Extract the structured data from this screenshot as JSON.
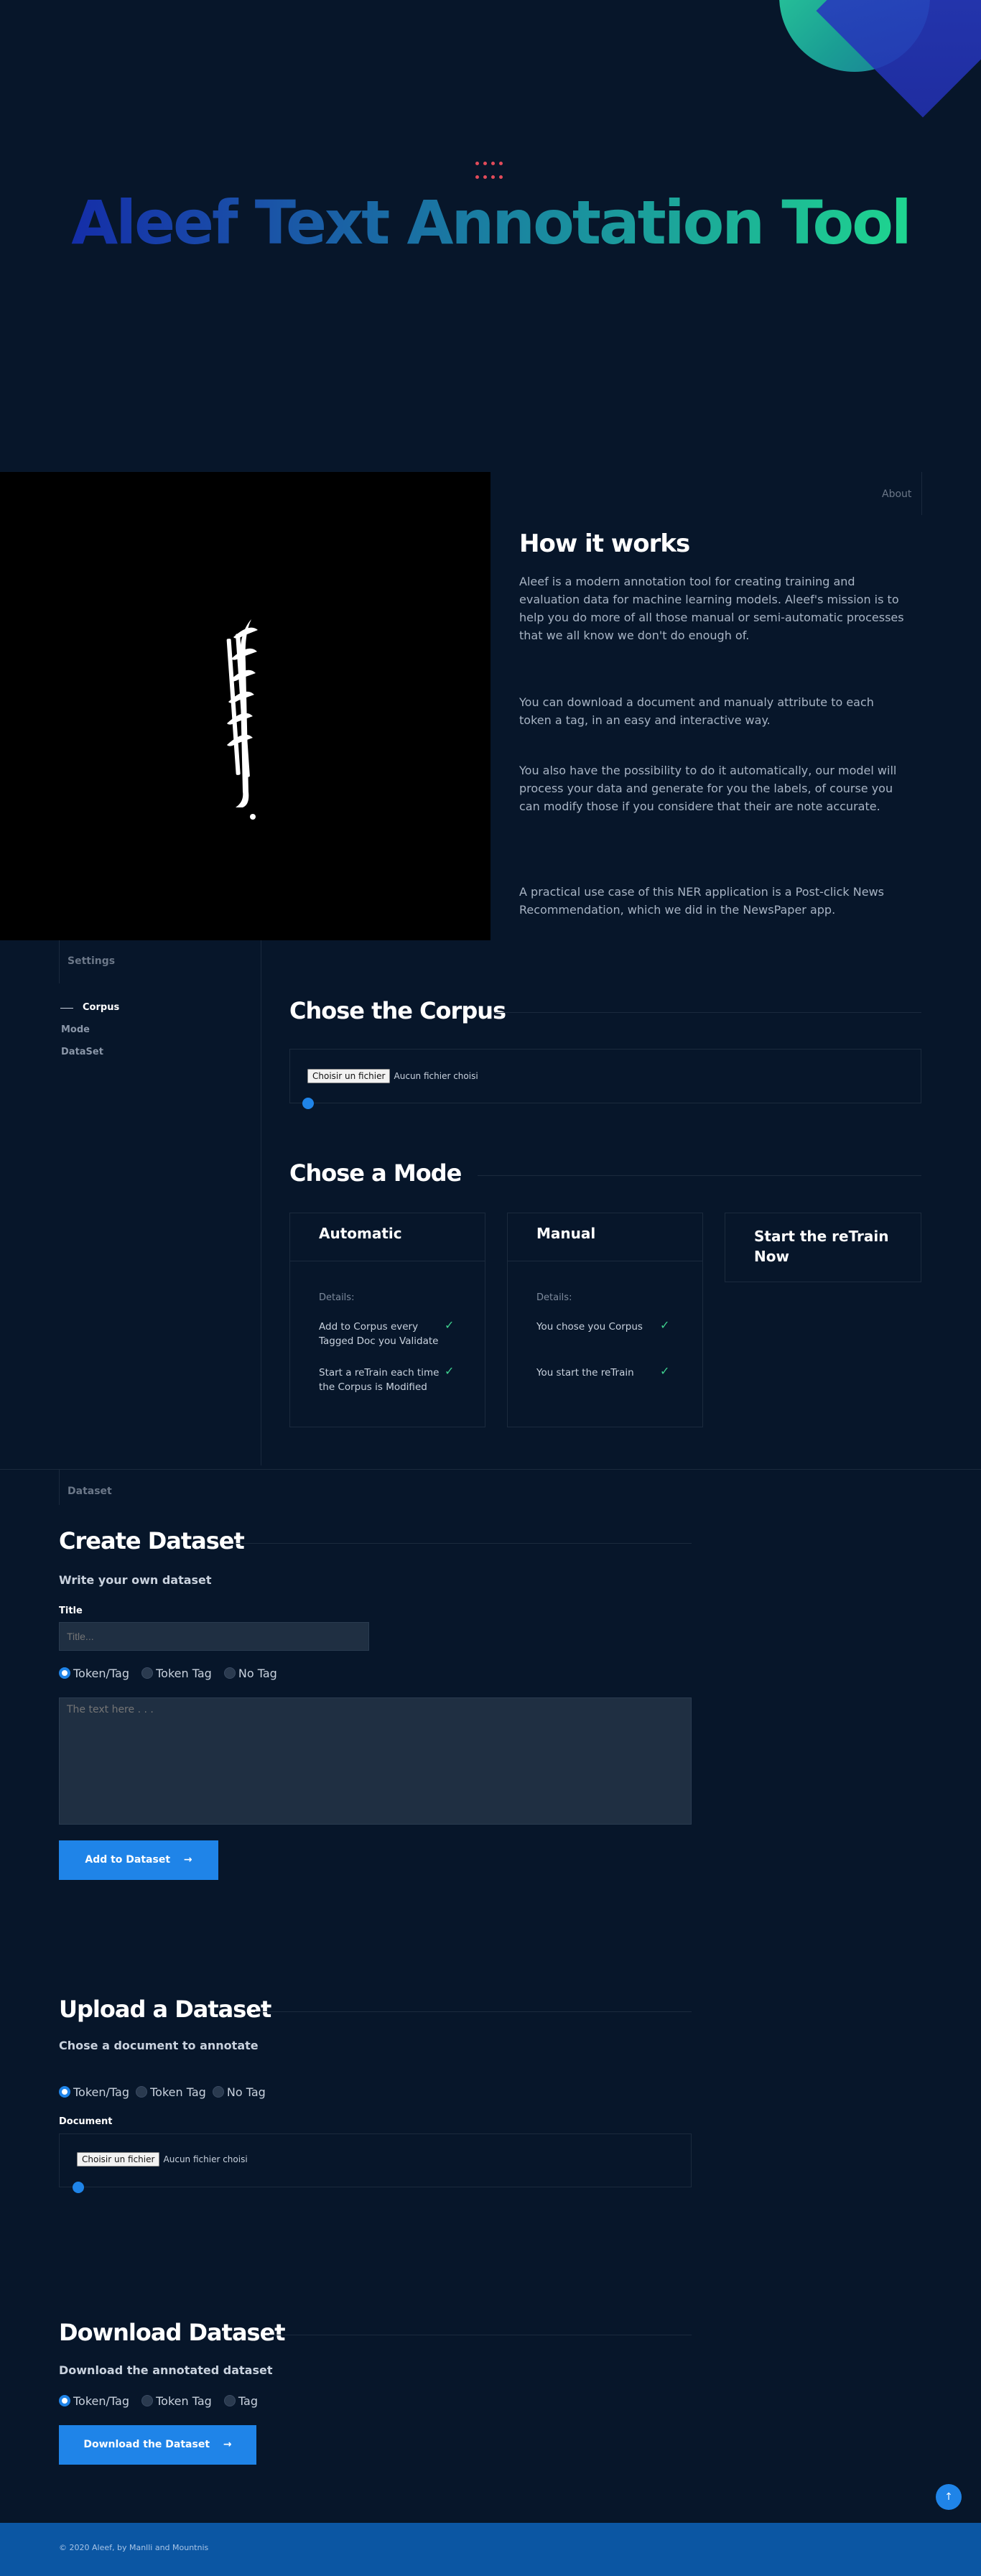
{
  "hero": {
    "title": "Aleef Text Annotation Tool"
  },
  "about": {
    "section_label": "About",
    "heading": "How it works",
    "paragraphs": [
      "Aleef is a modern annotation tool for creating training and evaluation data for machine learning models. Aleef's mission is to help you do more of all those manual or semi-automatic processes that we all know we don't do enough of.",
      "You can download a document and manualy attribute to each token a tag, in an easy and interactive way.",
      "You also have the possibility to do it automatically, our model will process your data and generate for you the labels, of course you can modify those if you considere that their are note accurate.",
      "A practical use case of this NER application is a Post-click News Recommendation, which we did in the NewsPaper app."
    ]
  },
  "settings": {
    "section_label": "Settings",
    "nav": [
      "Corpus",
      "Mode",
      "DataSet"
    ],
    "corpus_heading": "Chose the Corpus",
    "file_button": "Choisir un fichier",
    "file_status": "Aucun fichier choisi",
    "mode_heading": "Chose a Mode",
    "modes": [
      {
        "title": "Automatic",
        "details_label": "Details:",
        "items": [
          "Add to Corpus every Tagged Doc you Validate",
          "Start a reTrain each time the Corpus is Modified"
        ]
      },
      {
        "title": "Manual",
        "details_label": "Details:",
        "items": [
          "You chose you Corpus",
          "You start the reTrain"
        ]
      },
      {
        "title": "Start the reTrain Now"
      }
    ]
  },
  "dataset": {
    "section_label": "Dataset",
    "create": {
      "heading": "Create Dataset",
      "subheading": "Write your own dataset",
      "title_label": "Title",
      "title_placeholder": "Title...",
      "options": [
        "Token/Tag",
        "Token Tag",
        "No Tag"
      ],
      "text_placeholder": "The text here . . .",
      "button": "Add to Dataset"
    },
    "upload": {
      "heading": "Upload a Dataset",
      "subheading": "Chose a document to annotate",
      "options": [
        "Token/Tag",
        "Token Tag",
        "No Tag"
      ],
      "document_label": "Document",
      "file_button": "Choisir un fichier",
      "file_status": "Aucun fichier choisi"
    },
    "download": {
      "heading": "Download Dataset",
      "subheading": "Download the annotated dataset",
      "options": [
        "Token/Tag",
        "Token Tag",
        "Tag"
      ],
      "button": "Download the Dataset"
    }
  },
  "footer": {
    "text": "© 2020 Aleef, by Manlli and Mountnis"
  },
  "colors": {
    "accent": "#1f84e8",
    "background": "#07162a",
    "footer": "#0b56a3"
  },
  "icons": {
    "arrow": "arrow-right-icon",
    "check": "check-icon",
    "scroll_top": "arrow-up-icon"
  }
}
